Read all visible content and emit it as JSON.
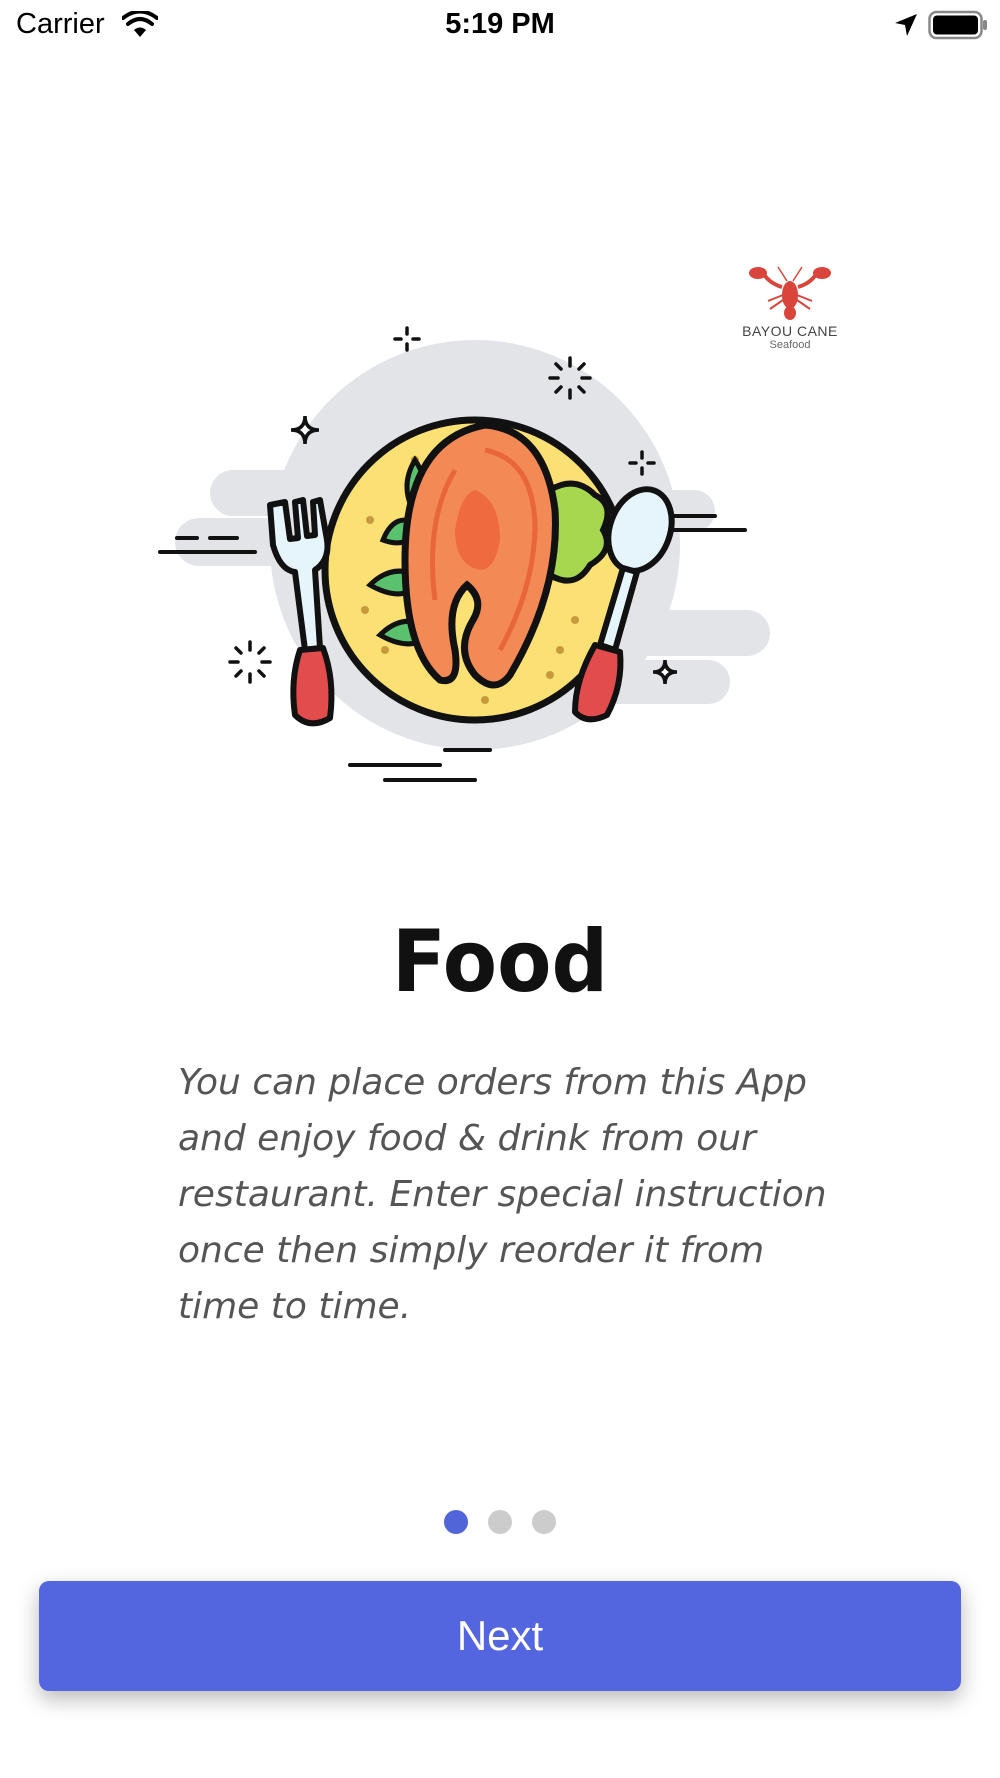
{
  "status_bar": {
    "carrier": "Carrier",
    "time": "5:19 PM",
    "icons": [
      "wifi-icon",
      "location-arrow-icon",
      "battery-icon"
    ]
  },
  "logo": {
    "line1": "BAYOU CANE",
    "line2": "Seafood",
    "color": "#d9453a"
  },
  "illustration": {
    "subject": "plate-with-salmon-fork-spoon"
  },
  "onboarding": {
    "title": "Food",
    "description": "You can place orders from this App and enjoy food & drink from our restaurant. Enter special instruction once then simply reorder it from time to time."
  },
  "pagination": {
    "total": 3,
    "current": 1
  },
  "next_button": {
    "label": "Next",
    "color": "#5366df"
  }
}
